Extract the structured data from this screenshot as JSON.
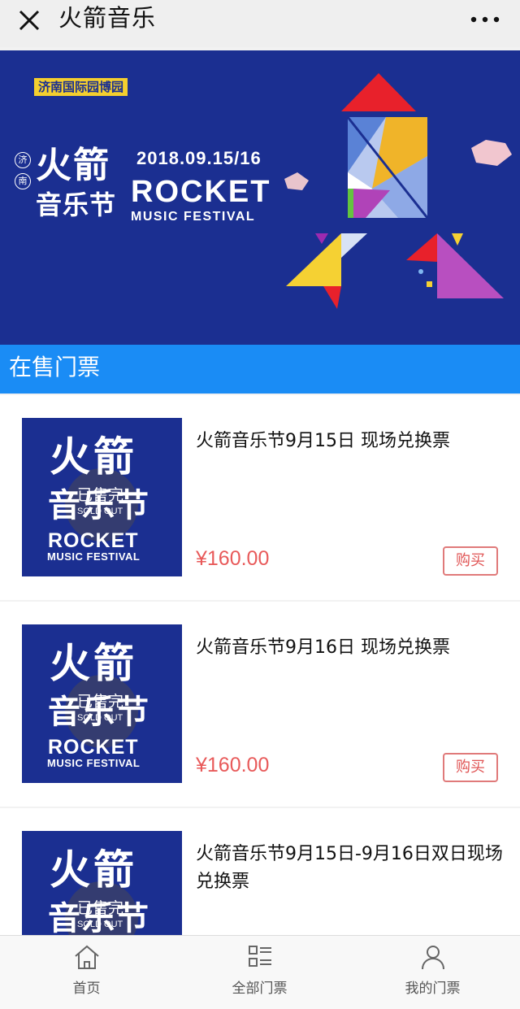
{
  "window": {
    "title": "火箭音乐",
    "close_icon": "close-icon",
    "more_icon": "more-horizontal-icon"
  },
  "banner": {
    "venue": "济南国际园博园",
    "city_char_1": "济",
    "city_char_2": "南",
    "cn_title_1": "火箭",
    "cn_title_2": "音乐节",
    "date": "2018.09.15/16",
    "en_title": "ROCKET",
    "en_subtitle": "MUSIC FESTIVAL"
  },
  "section": {
    "title": "在售门票"
  },
  "thumbnail": {
    "cn_1": "火箭",
    "cn_2": "音乐节",
    "en_1": "ROCKET",
    "en_2": "MUSIC FESTIVAL",
    "sold_cn": "已售完",
    "sold_en": "SOLD OUT"
  },
  "tickets": [
    {
      "name": "火箭音乐节9月15日 现场兑换票",
      "price": "¥160.00",
      "buy_label": "购买"
    },
    {
      "name": "火箭音乐节9月16日 现场兑换票",
      "price": "¥160.00",
      "buy_label": "购买"
    },
    {
      "name": "火箭音乐节9月15日-9月16日双日现场兑换票",
      "price": "",
      "buy_label": ""
    }
  ],
  "tabbar": {
    "items": [
      {
        "label": "首页",
        "icon": "home-icon"
      },
      {
        "label": "全部门票",
        "icon": "list-icon"
      },
      {
        "label": "我的门票",
        "icon": "user-icon"
      }
    ]
  },
  "colors": {
    "banner_bg": "#1b2f91",
    "section_bg": "#1a8cf5",
    "price": "#e85a5a",
    "accent_yellow": "#f4cf2f"
  }
}
